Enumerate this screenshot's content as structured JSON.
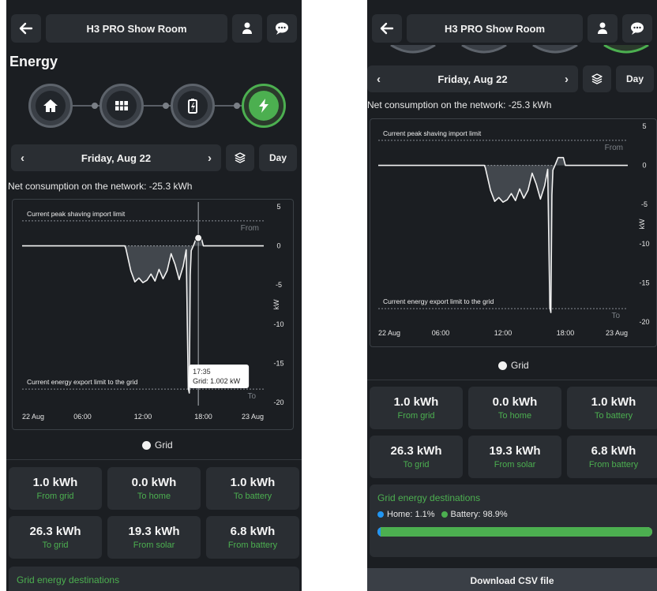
{
  "app": {
    "title": "H3 PRO Show Room",
    "back_icon": "arrow-left-icon",
    "user_icon": "user-icon",
    "chat_icon": "chat-icon"
  },
  "page_title": "Energy",
  "modes": [
    {
      "name": "home",
      "icon": "house-icon",
      "active": false
    },
    {
      "name": "solar",
      "icon": "solar-panel-icon",
      "active": false
    },
    {
      "name": "battery",
      "icon": "battery-icon",
      "active": false
    },
    {
      "name": "grid",
      "icon": "lightning-icon",
      "active": true
    }
  ],
  "date_nav": {
    "prev": "‹",
    "next": "›",
    "label": "Friday, Aug 22",
    "layers_icon": "layers-icon",
    "period": "Day"
  },
  "net_consumption": "Net consumption on the network: -25.3 kWh",
  "chart_data": {
    "type": "line",
    "ylabel": "kW",
    "ylim": [
      -20,
      5
    ],
    "yticks": [
      "5",
      "0",
      "-5",
      "-10",
      "-15",
      "-20"
    ],
    "xticks": [
      "22 Aug",
      "06:00",
      "12:00",
      "18:00",
      "23 Aug"
    ],
    "annotations": {
      "import_limit": "Current peak shaving import limit",
      "export_limit": "Current energy export limit to the grid",
      "from": "From",
      "to": "To"
    },
    "tooltip": {
      "time": "17:35",
      "text": "Grid: 1.002 kW"
    },
    "series": [
      {
        "name": "Grid",
        "color": "#f2f2f2",
        "hours": [
          0,
          10.2,
          10.3,
          10.8,
          11.2,
          11.6,
          12.0,
          12.4,
          12.8,
          13.2,
          13.6,
          14.0,
          14.4,
          14.8,
          15.2,
          15.6,
          16.0,
          16.2,
          16.3,
          16.5,
          16.6,
          16.7,
          16.8,
          17.0,
          17.3,
          17.5,
          17.8,
          18.0,
          18.2,
          24
        ],
        "values": [
          0,
          0,
          -0.3,
          -3.2,
          -4.6,
          -4.1,
          -4.7,
          -4.4,
          -3.6,
          -4.5,
          -3.0,
          -4.2,
          -3.2,
          -1.0,
          -2.4,
          -4.3,
          -2.6,
          -1.2,
          -0.5,
          -18.2,
          -18.8,
          -3.8,
          -0.6,
          0.0,
          1.0,
          1.0,
          1.0,
          0.0,
          0.0,
          0
        ]
      }
    ]
  },
  "legend": {
    "grid": "Grid"
  },
  "tiles": [
    {
      "value": "1.0 kWh",
      "label": "From grid"
    },
    {
      "value": "0.0 kWh",
      "label": "To home"
    },
    {
      "value": "1.0 kWh",
      "label": "To battery"
    },
    {
      "value": "26.3 kWh",
      "label": "To grid"
    },
    {
      "value": "19.3 kWh",
      "label": "From solar"
    },
    {
      "value": "6.8 kWh",
      "label": "From battery"
    }
  ],
  "grid_destinations": {
    "title": "Grid energy destinations",
    "home_label": "Home: 1.1%",
    "battery_label": "Battery: 98.9%",
    "home_pct": 1.1,
    "battery_pct": 98.9,
    "home_color": "#2196f3",
    "battery_color": "#4caf50"
  },
  "download_label": "Download CSV file",
  "colors": {
    "accent": "#4caf50",
    "background": "#1b1e22",
    "panel": "#2a2e33"
  }
}
